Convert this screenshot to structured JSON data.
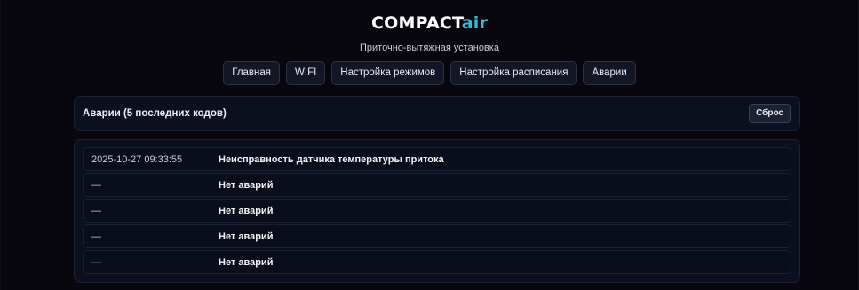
{
  "header": {
    "brand_main": "COMPACT",
    "brand_accent": "air",
    "subtitle": "Приточно-вытяжная установка"
  },
  "nav": {
    "items": [
      {
        "label": "Главная"
      },
      {
        "label": "WIFI"
      },
      {
        "label": "Настройка режимов"
      },
      {
        "label": "Настройка расписания"
      },
      {
        "label": "Аварии"
      }
    ]
  },
  "alarms": {
    "title": "Аварии (5 последних кодов)",
    "reset_label": "Сброс",
    "rows": [
      {
        "time": "2025-10-27 09:33:55",
        "message": "Неисправность датчика температуры притока"
      },
      {
        "time": "—",
        "message": "Нет аварий"
      },
      {
        "time": "—",
        "message": "Нет аварий"
      },
      {
        "time": "—",
        "message": "Нет аварий"
      },
      {
        "time": "—",
        "message": "Нет аварий"
      }
    ]
  },
  "colors": {
    "background": "#07070d",
    "accent": "#39b9d8",
    "panel": "#0c0f1e"
  }
}
